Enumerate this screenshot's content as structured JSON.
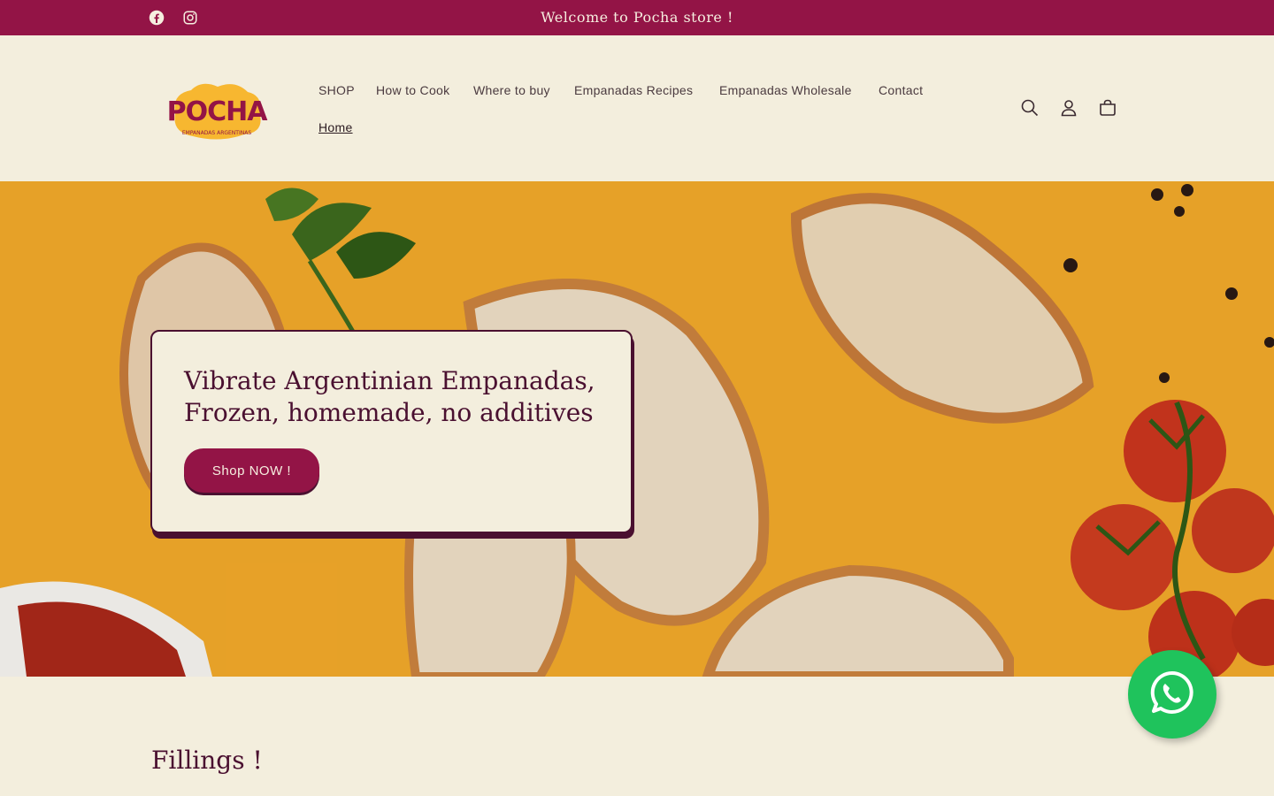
{
  "announcement": {
    "text": "Welcome to Pocha store !"
  },
  "social": [
    "facebook-icon",
    "instagram-icon"
  ],
  "logo": {
    "name": "POCHA",
    "tagline": "EMPANADAS ARGENTINAS"
  },
  "nav": {
    "items": [
      "SHOP",
      "How to Cook",
      "Where to buy",
      "Empanadas Recipes",
      "Empanadas Wholesale",
      "Contact",
      "Home"
    ],
    "active": "Home"
  },
  "header_icons": [
    "search-icon",
    "account-icon",
    "cart-icon"
  ],
  "hero": {
    "title": "Vibrate Argentinian Empanadas, Frozen, homemade, no additives",
    "button": "Shop NOW !"
  },
  "fillings": {
    "title": "Fillings !"
  },
  "colors": {
    "brand": "#931446",
    "dark": "#4a1030",
    "cream": "#f3eedd",
    "hero_bg": "#f0a82a",
    "whatsapp": "#1fc35c"
  }
}
